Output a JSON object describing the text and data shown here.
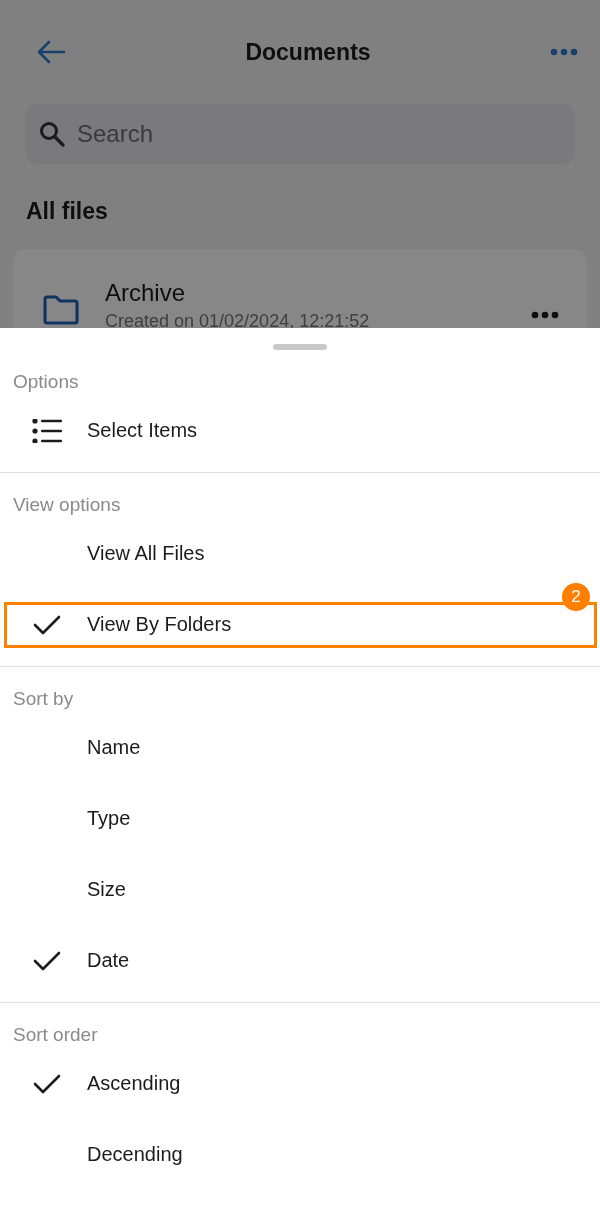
{
  "header": {
    "title": "Documents"
  },
  "search": {
    "placeholder": "Search"
  },
  "section_title": "All files",
  "files": [
    {
      "name": "Archive",
      "subtitle": "Created on 01/02/2024, 12:21:52"
    }
  ],
  "sheet": {
    "sections": [
      {
        "title": "Options",
        "items": [
          {
            "label": "Select Items",
            "kind": "action"
          }
        ]
      },
      {
        "title": "View options",
        "items": [
          {
            "label": "View All Files",
            "kind": "option",
            "selected": false
          },
          {
            "label": "View By Folders",
            "kind": "option",
            "selected": true,
            "annotation": "2"
          }
        ]
      },
      {
        "title": "Sort by",
        "items": [
          {
            "label": "Name",
            "kind": "option",
            "selected": false
          },
          {
            "label": "Type",
            "kind": "option",
            "selected": false
          },
          {
            "label": "Size",
            "kind": "option",
            "selected": false
          },
          {
            "label": "Date",
            "kind": "option",
            "selected": true
          }
        ]
      },
      {
        "title": "Sort order",
        "items": [
          {
            "label": "Ascending",
            "kind": "option",
            "selected": true
          },
          {
            "label": "Decending",
            "kind": "option",
            "selected": false
          }
        ]
      }
    ]
  }
}
